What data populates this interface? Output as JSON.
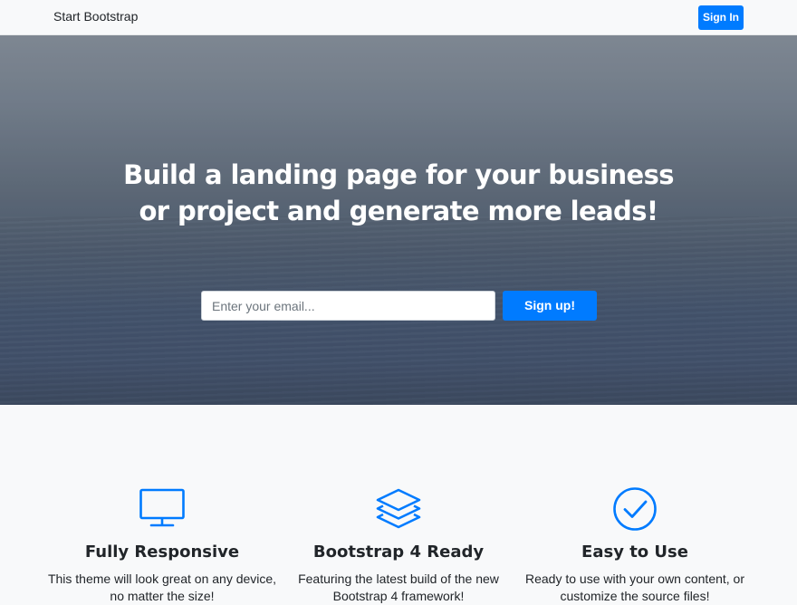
{
  "navbar": {
    "brand": "Start Bootstrap",
    "signin_label": "Sign In"
  },
  "masthead": {
    "headline_line1": "Build a landing page for your business",
    "headline_line2": "or project and generate more leads!",
    "email_placeholder": "Enter your email...",
    "signup_label": "Sign up!"
  },
  "features": [
    {
      "icon": "monitor-icon",
      "title": "Fully Responsive",
      "description": "This theme will look great on any device, no matter the size!"
    },
    {
      "icon": "layers-icon",
      "title": "Bootstrap 4 Ready",
      "description": "Featuring the latest build of the new Bootstrap 4 framework!"
    },
    {
      "icon": "check-circle-icon",
      "title": "Easy to Use",
      "description": "Ready to use with your own content, or customize the source files!"
    }
  ],
  "colors": {
    "accent": "#007bff",
    "background": "#f8f9fa",
    "text": "#212529"
  }
}
